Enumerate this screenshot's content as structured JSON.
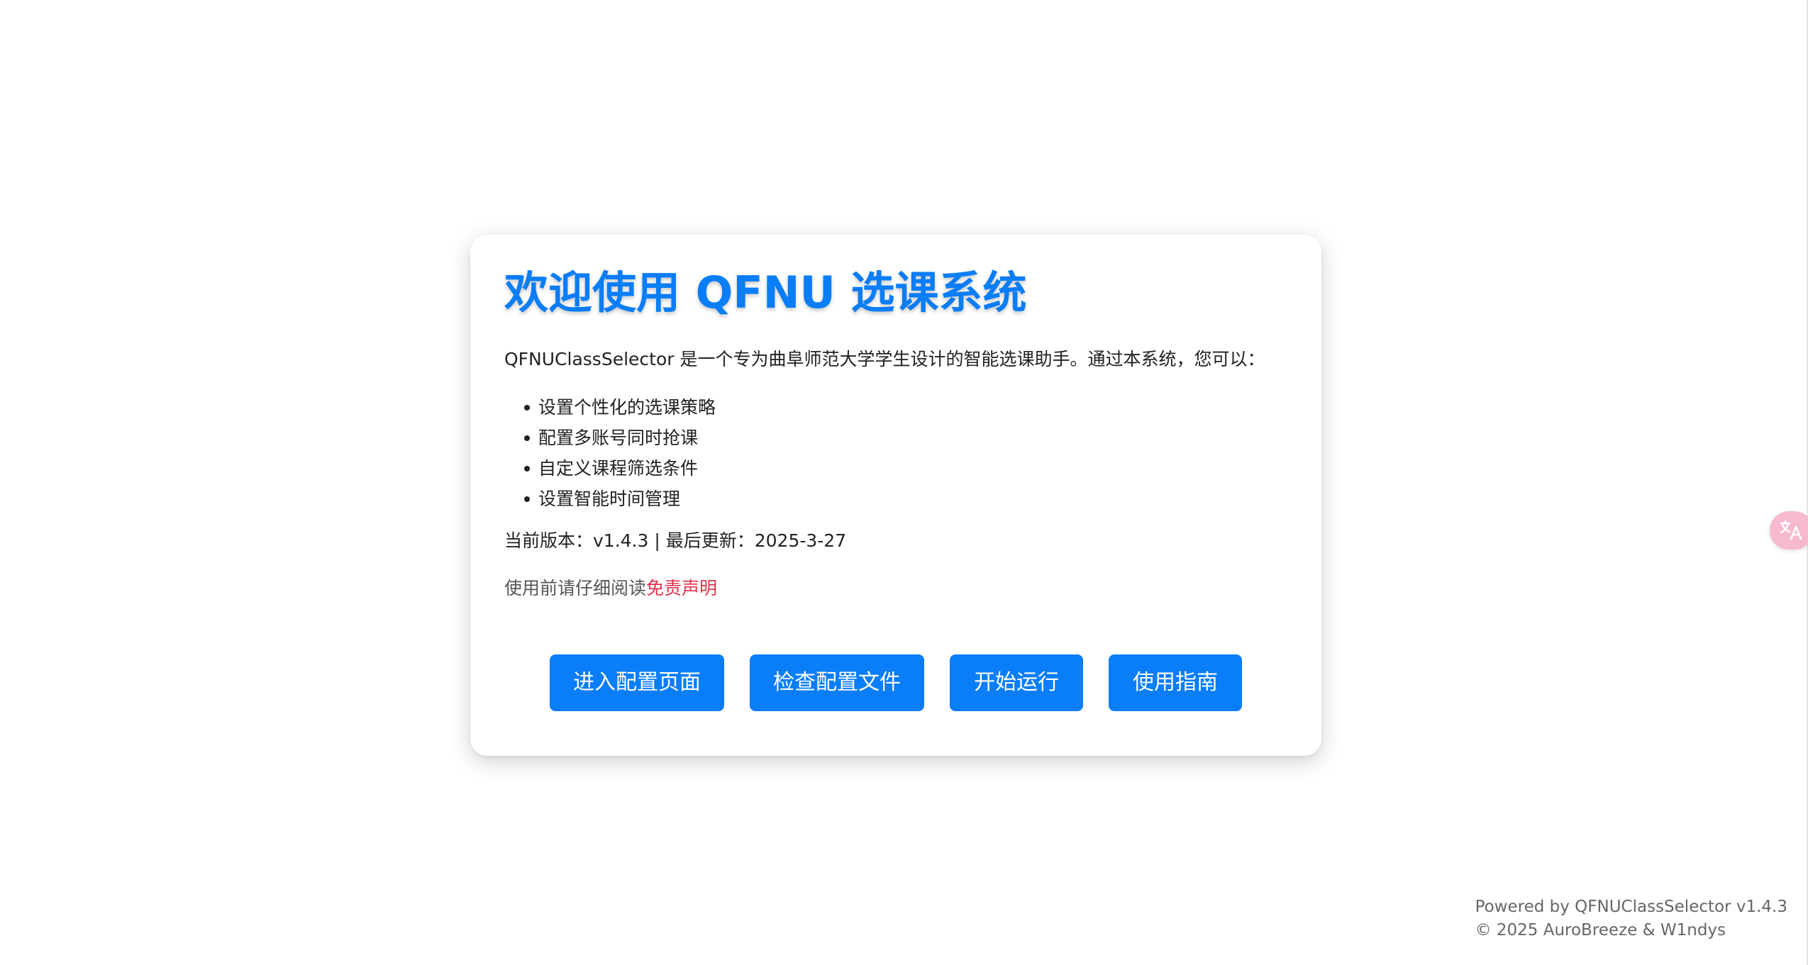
{
  "card": {
    "title": "欢迎使用 QFNU 选课系统",
    "intro": "QFNUClassSelector 是一个专为曲阜师范大学学生设计的智能选课助手。通过本系统，您可以：",
    "features": [
      "设置个性化的选课策略",
      "配置多账号同时抢课",
      "自定义课程筛选条件",
      "设置智能时间管理"
    ],
    "version_line": "当前版本：v1.4.3 | 最后更新：2025-3-27",
    "disclaimer_prefix": "使用前请仔细阅读",
    "disclaimer_link": "免责声明"
  },
  "buttons": {
    "config": "进入配置页面",
    "check": "检查配置文件",
    "run": "开始运行",
    "guide": "使用指南"
  },
  "footer": {
    "powered_by": "Powered by QFNUClassSelector v1.4.3",
    "copyright": "© 2025 AuroBreeze & W1ndys"
  },
  "floating": {
    "icon": "translate-icon"
  },
  "colors": {
    "accent": "#0a7df8",
    "link_red": "#e0314a",
    "translate_pink": "#f7b9cd"
  }
}
